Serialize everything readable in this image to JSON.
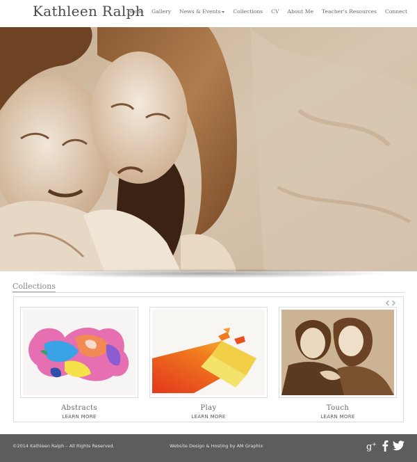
{
  "site": {
    "name": "Kathleen Ralph"
  },
  "nav": {
    "items": [
      {
        "label": "Home"
      },
      {
        "label": "Gallery"
      },
      {
        "label": "News & Events"
      },
      {
        "label": "Collections"
      },
      {
        "label": "CV"
      },
      {
        "label": "About Me"
      },
      {
        "label": "Teacher's Resources"
      },
      {
        "label": "Connect"
      }
    ]
  },
  "collections": {
    "title": "Collections",
    "cards": [
      {
        "title": "Abstracts",
        "link": "LEARN MORE"
      },
      {
        "title": "Play",
        "link": "LEARN MORE"
      },
      {
        "title": "Touch",
        "link": "LEARN MORE"
      }
    ]
  },
  "footer": {
    "copyright": "©2014 Kathleen Ralph – All Rights Reserved.",
    "credit": "Website Design & Hosting by AM Graphix"
  },
  "colors": {
    "footer_bg": "#5d5d5d",
    "sepia": "#8a5a32"
  },
  "icons": [
    "google-plus-icon",
    "facebook-icon",
    "twitter-icon",
    "chevron-left-icon",
    "chevron-right-icon"
  ]
}
